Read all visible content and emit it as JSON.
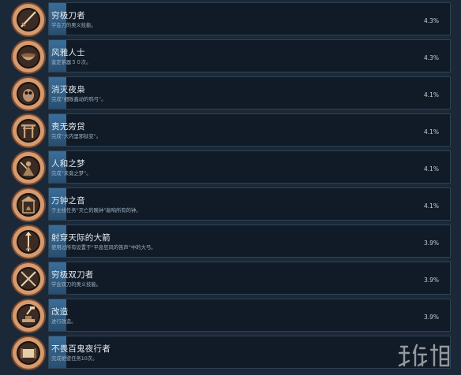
{
  "achievements": [
    {
      "title": "穷极刀者",
      "description": "学会刀的奥义技能。",
      "percent": "4.3%",
      "icon": "katana-icon"
    },
    {
      "title": "风雅人士",
      "description": "鉴定茶器５０次。",
      "percent": "4.3%",
      "icon": "tea-bowl-icon"
    },
    {
      "title": "消灭夜枭",
      "description": "完成“细致鑫动的鸮弓”。",
      "percent": "4.1%",
      "icon": "owl-icon"
    },
    {
      "title": "责无旁贷",
      "description": "完成“大内里邪狱变”。",
      "percent": "4.1%",
      "icon": "shrine-gate-icon"
    },
    {
      "title": "人和之梦",
      "description": "完成“未竟之梦”。",
      "percent": "4.1%",
      "icon": "warrior-icon"
    },
    {
      "title": "万钟之音",
      "description": "于主线任务“灭亡的晚钟”敲响所有的钟。",
      "percent": "4.1%",
      "icon": "bell-tower-icon"
    },
    {
      "title": "射穿天际的大箭",
      "description": "使用过所有设置于“平息狂风的笛声”中的大弓。",
      "percent": "3.9%",
      "icon": "great-arrow-icon"
    },
    {
      "title": "穷极双刀者",
      "description": "学会双刀的奥义技能。",
      "percent": "3.9%",
      "icon": "dual-swords-icon"
    },
    {
      "title": "改造",
      "description": "进行改造。",
      "percent": "3.9%",
      "icon": "forge-icon"
    },
    {
      "title": "不畏百鬼夜行者",
      "description": "完成绝壁任务10次。",
      "percent": "",
      "icon": "scroll-icon"
    }
  ],
  "progress_fraction": [
    0.043,
    0.043,
    0.041,
    0.041,
    0.041,
    0.041,
    0.039,
    0.039,
    0.039,
    0.039
  ],
  "watermark": {
    "text": "游侠网",
    "icon": "gamersky-logo"
  },
  "colors": {
    "page_bg": "#1b2838",
    "bar_bg": "#111b27",
    "bar_border": "#2d4456",
    "progress_fill": "#33628c",
    "title_text": "#e6edf2",
    "desc_text": "#9fb2c2",
    "medal_bronze": "#c98b63"
  }
}
